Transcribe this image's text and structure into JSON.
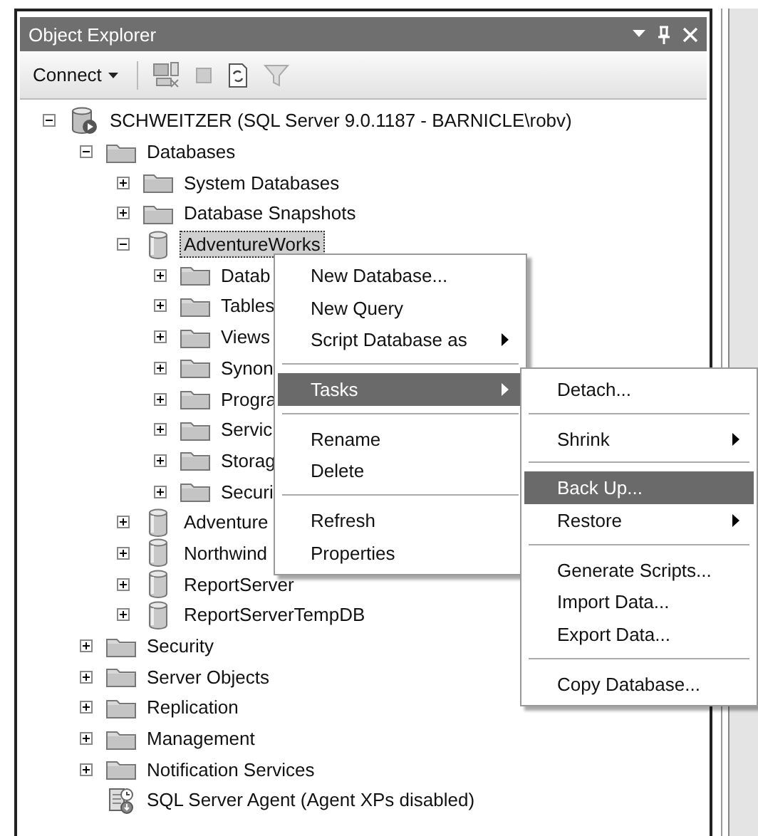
{
  "panel": {
    "title": "Object Explorer"
  },
  "toolbar": {
    "connect_label": "Connect"
  },
  "tree": [
    {
      "label": "SCHWEITZER (SQL Server 9.0.1187 - BARNICLE\\robv)",
      "kind": "server",
      "expanded": true,
      "selected": false,
      "children": [
        {
          "label": "Databases",
          "kind": "folder",
          "expanded": true,
          "selected": false,
          "children": [
            {
              "label": "System Databases",
              "kind": "folder",
              "expanded": false,
              "selected": false
            },
            {
              "label": "Database Snapshots",
              "kind": "folder",
              "expanded": false,
              "selected": false
            },
            {
              "label": "AdventureWorks",
              "kind": "database",
              "expanded": true,
              "selected": true,
              "children": [
                {
                  "label": "Datab",
                  "kind": "folder",
                  "expanded": false,
                  "selected": false
                },
                {
                  "label": "Tables",
                  "kind": "folder",
                  "expanded": false,
                  "selected": false
                },
                {
                  "label": "Views",
                  "kind": "folder",
                  "expanded": false,
                  "selected": false
                },
                {
                  "label": "Synon",
                  "kind": "folder",
                  "expanded": false,
                  "selected": false
                },
                {
                  "label": "Progra",
                  "kind": "folder",
                  "expanded": false,
                  "selected": false
                },
                {
                  "label": "Servic",
                  "kind": "folder",
                  "expanded": false,
                  "selected": false
                },
                {
                  "label": "Storag",
                  "kind": "folder",
                  "expanded": false,
                  "selected": false
                },
                {
                  "label": "Securi",
                  "kind": "folder",
                  "expanded": false,
                  "selected": false
                }
              ]
            },
            {
              "label": "Adventure",
              "kind": "database",
              "expanded": false,
              "selected": false
            },
            {
              "label": "Northwind",
              "kind": "database",
              "expanded": false,
              "selected": false
            },
            {
              "label": "ReportServer",
              "kind": "database",
              "expanded": false,
              "selected": false
            },
            {
              "label": "ReportServerTempDB",
              "kind": "database",
              "expanded": false,
              "selected": false
            }
          ]
        },
        {
          "label": "Security",
          "kind": "folder",
          "expanded": false,
          "selected": false
        },
        {
          "label": "Server Objects",
          "kind": "folder",
          "expanded": false,
          "selected": false
        },
        {
          "label": "Replication",
          "kind": "folder",
          "expanded": false,
          "selected": false
        },
        {
          "label": "Management",
          "kind": "folder",
          "expanded": false,
          "selected": false
        },
        {
          "label": "Notification Services",
          "kind": "folder",
          "expanded": false,
          "selected": false
        },
        {
          "label": "SQL Server Agent (Agent XPs disabled)",
          "kind": "agent",
          "selected": false
        }
      ]
    }
  ],
  "context_menu": {
    "items": [
      {
        "kind": "item",
        "label": "New Database...",
        "submenu": false,
        "selected": false
      },
      {
        "kind": "item",
        "label": "New Query",
        "submenu": false,
        "selected": false
      },
      {
        "kind": "item",
        "label": "Script Database as",
        "submenu": true,
        "selected": false
      },
      {
        "kind": "separator"
      },
      {
        "kind": "item",
        "label": "Tasks",
        "submenu": true,
        "selected": true
      },
      {
        "kind": "separator"
      },
      {
        "kind": "item",
        "label": "Rename",
        "submenu": false,
        "selected": false
      },
      {
        "kind": "item",
        "label": "Delete",
        "submenu": false,
        "selected": false
      },
      {
        "kind": "separator"
      },
      {
        "kind": "item",
        "label": "Refresh",
        "submenu": false,
        "selected": false
      },
      {
        "kind": "item",
        "label": "Properties",
        "submenu": false,
        "selected": false
      }
    ]
  },
  "tasks_submenu": {
    "items": [
      {
        "kind": "item",
        "label": "Detach...",
        "submenu": false,
        "selected": false
      },
      {
        "kind": "separator"
      },
      {
        "kind": "item",
        "label": "Shrink",
        "submenu": true,
        "selected": false
      },
      {
        "kind": "separator"
      },
      {
        "kind": "item",
        "label": "Back Up...",
        "submenu": false,
        "selected": true
      },
      {
        "kind": "item",
        "label": "Restore",
        "submenu": true,
        "selected": false
      },
      {
        "kind": "separator"
      },
      {
        "kind": "item",
        "label": "Generate Scripts...",
        "submenu": false,
        "selected": false
      },
      {
        "kind": "item",
        "label": "Import Data...",
        "submenu": false,
        "selected": false
      },
      {
        "kind": "item",
        "label": "Export Data...",
        "submenu": false,
        "selected": false
      },
      {
        "kind": "separator"
      },
      {
        "kind": "item",
        "label": "Copy Database...",
        "submenu": false,
        "selected": false
      }
    ]
  }
}
